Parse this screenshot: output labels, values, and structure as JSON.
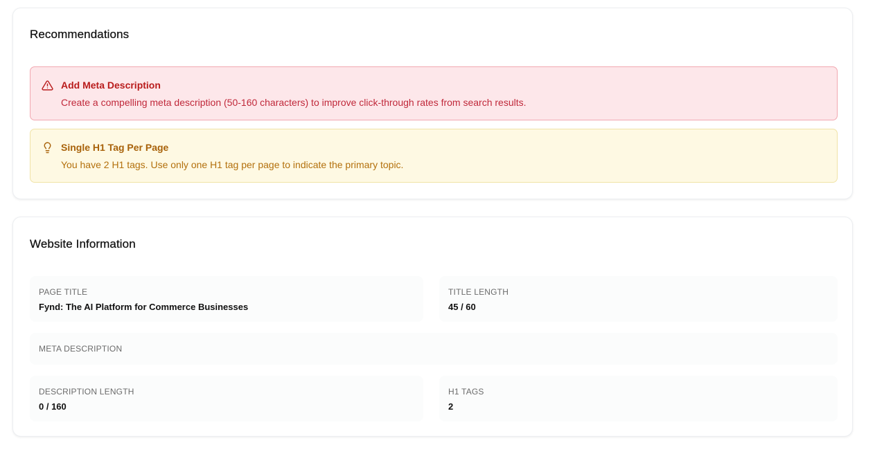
{
  "recommendations": {
    "title": "Recommendations",
    "items": [
      {
        "type": "error",
        "icon": "warning-triangle-icon",
        "title": "Add Meta Description",
        "text": "Create a compelling meta description (50-160 characters) to improve click-through rates from search results.",
        "color": "#b91c1c"
      },
      {
        "type": "tip",
        "icon": "lightbulb-icon",
        "title": "Single H1 Tag Per Page",
        "text": "You have 2 H1 tags. Use only one H1 tag per page to indicate the primary topic.",
        "color": "#a8620a"
      }
    ]
  },
  "website_info": {
    "title": "Website Information",
    "page_title": {
      "label": "PAGE TITLE",
      "value": "Fynd: The AI Platform for Commerce Businesses"
    },
    "title_length": {
      "label": "TITLE LENGTH",
      "value": "45 / 60"
    },
    "meta_description": {
      "label": "META DESCRIPTION",
      "value": ""
    },
    "description_length": {
      "label": "DESCRIPTION LENGTH",
      "value": "0 / 160"
    },
    "h1_tags": {
      "label": "H1 TAGS",
      "value": "2"
    }
  }
}
